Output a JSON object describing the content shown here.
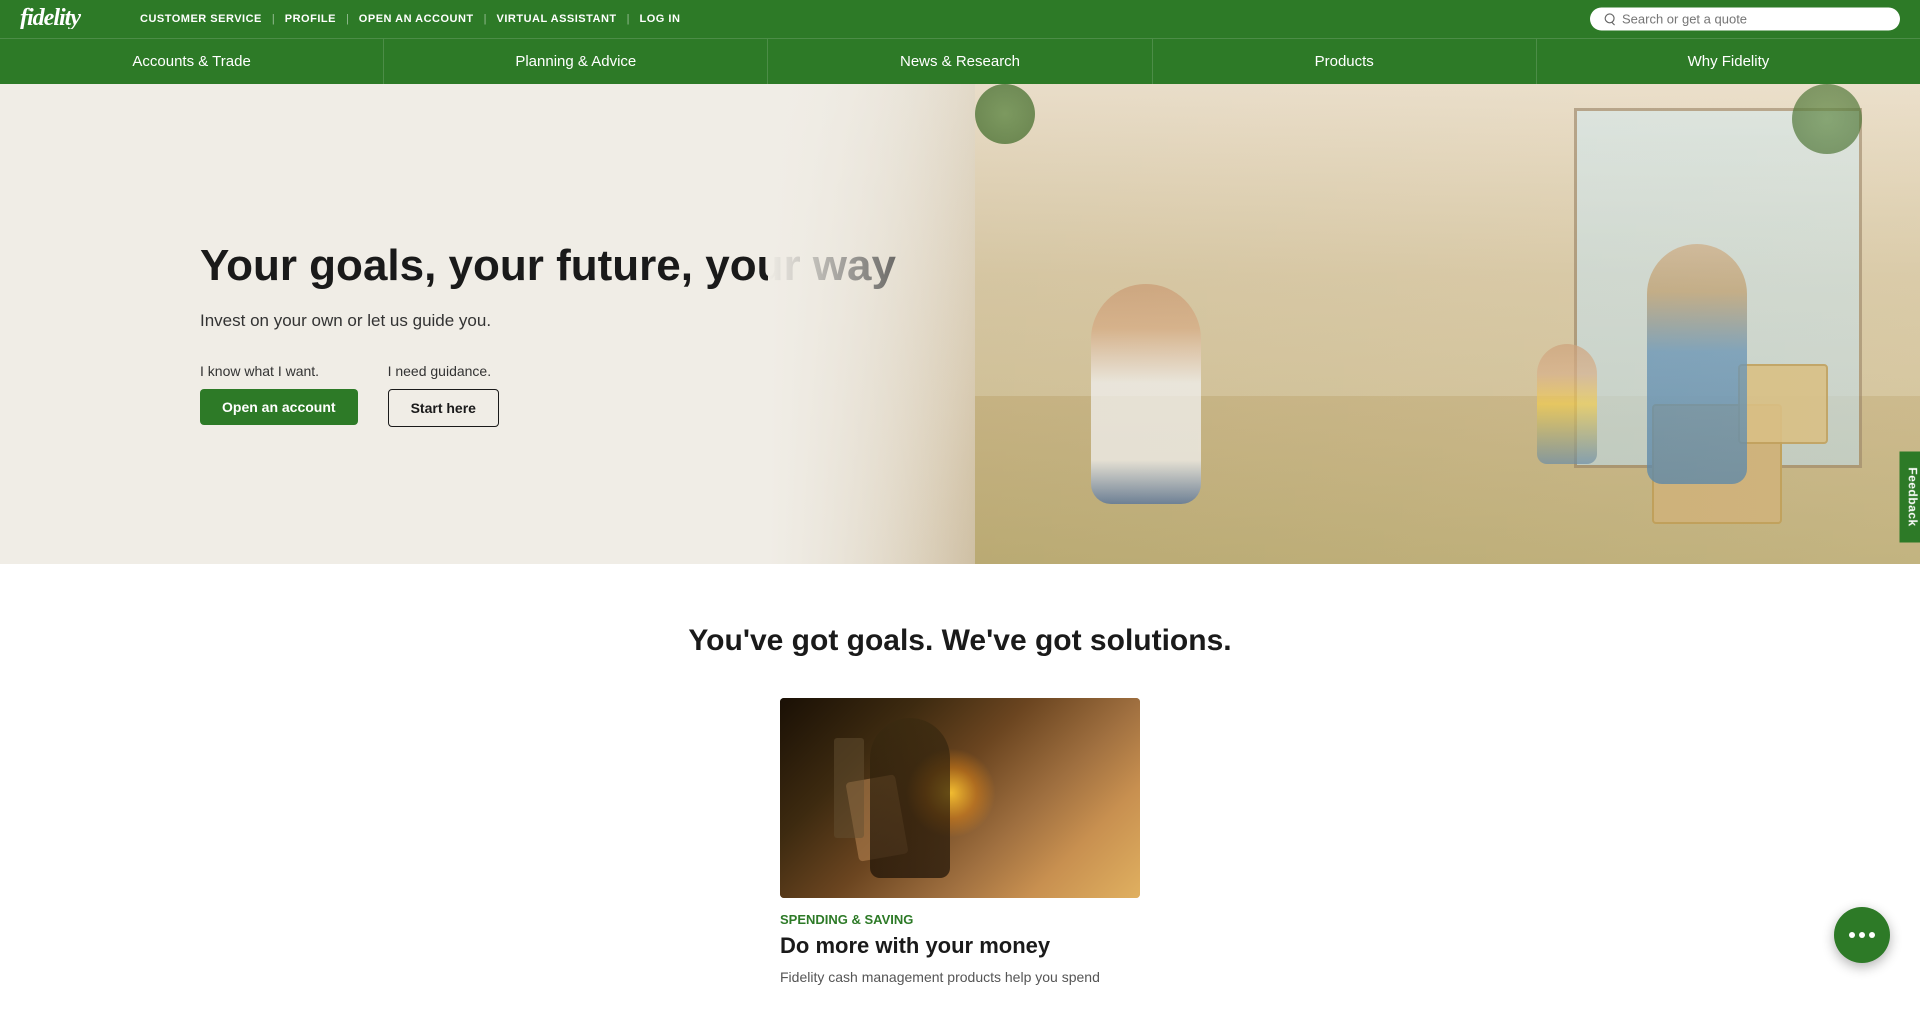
{
  "topbar": {
    "logo": "fidelity",
    "nav_items": [
      {
        "label": "CUSTOMER SERVICE",
        "id": "customer-service"
      },
      {
        "label": "PROFILE",
        "id": "profile"
      },
      {
        "label": "OPEN AN ACCOUNT",
        "id": "open-account"
      },
      {
        "label": "VIRTUAL ASSISTANT",
        "id": "virtual-assistant"
      },
      {
        "label": "LOG IN",
        "id": "log-in"
      }
    ],
    "search_placeholder": "Search or get a quote"
  },
  "main_nav": {
    "items": [
      {
        "label": "Accounts & Trade",
        "id": "accounts-trade"
      },
      {
        "label": "Planning & Advice",
        "id": "planning-advice"
      },
      {
        "label": "News & Research",
        "id": "news-research"
      },
      {
        "label": "Products",
        "id": "products"
      },
      {
        "label": "Why Fidelity",
        "id": "why-fidelity"
      }
    ]
  },
  "hero": {
    "title": "Your goals, your future, your way",
    "subtitle": "Invest on your own or let us guide you.",
    "left_cta": {
      "label": "I know what I want.",
      "button": "Open an account"
    },
    "right_cta": {
      "label": "I need guidance.",
      "button": "Start here"
    }
  },
  "goals_section": {
    "title": "You've got goals. We've got solutions.",
    "cards": [
      {
        "category": "Spending & saving",
        "title": "Do more with your money",
        "description": "Fidelity cash management products help you spend"
      }
    ]
  },
  "feedback": {
    "label": "Feedback"
  },
  "chat": {
    "dots": 3
  }
}
